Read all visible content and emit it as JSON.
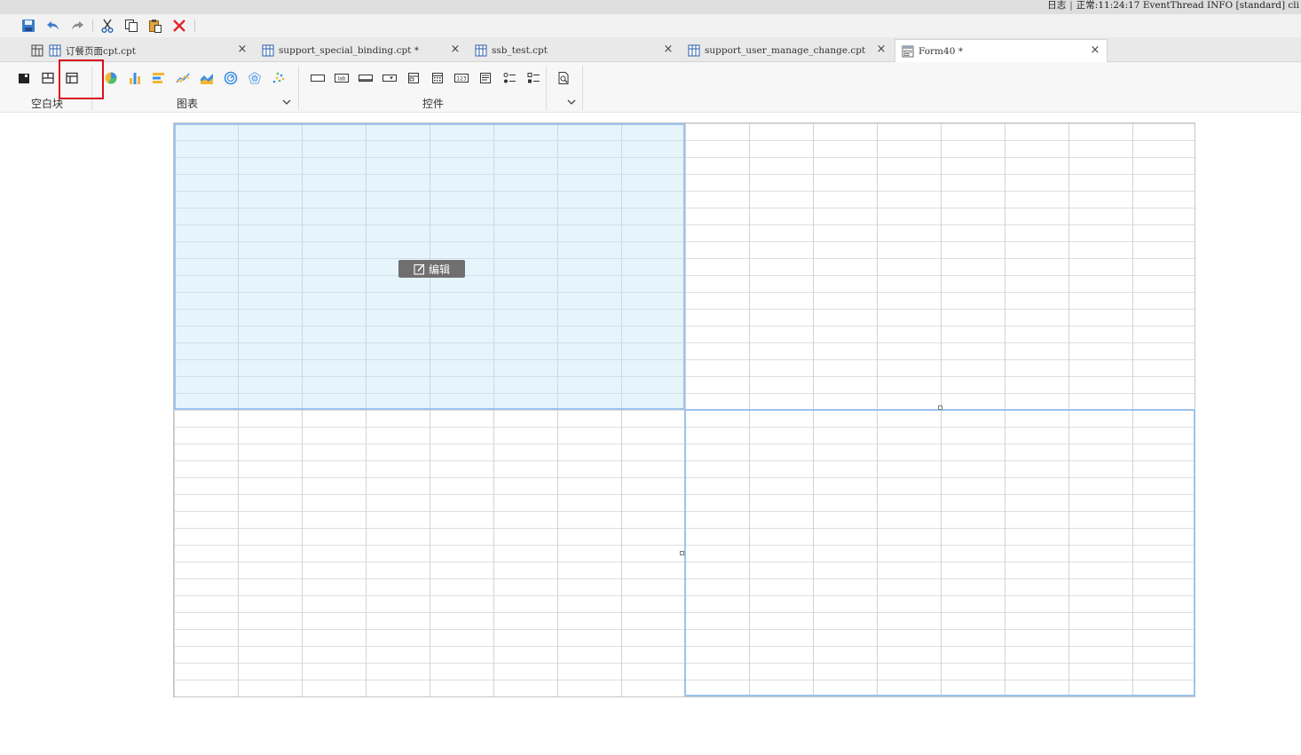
{
  "status": {
    "log_label": "日志",
    "log_message": "正常:11:24:17 EventThread INFO [standard] cli"
  },
  "quickbar": {
    "icons": [
      "save-icon",
      "undo-icon",
      "redo-icon",
      "cut-icon",
      "copy-icon",
      "paste-icon",
      "delete-icon"
    ]
  },
  "tabs": [
    {
      "label": "订餐页面cpt.cpt",
      "icon": "report-icon",
      "active": false
    },
    {
      "label": "support_special_binding.cpt *",
      "icon": "report-icon",
      "active": false
    },
    {
      "label": "ssb_test.cpt",
      "icon": "report-icon",
      "active": false
    },
    {
      "label": "support_user_manage_change.cpt",
      "icon": "report-icon",
      "active": false
    },
    {
      "label": "Form40 *",
      "icon": "form-icon",
      "active": true
    }
  ],
  "tab_close_glyph": "×",
  "ribbon": {
    "blank_group": {
      "label": "空白块",
      "icons": [
        "absolute-layout-icon",
        "tab-layout-icon",
        "frame-layout-icon"
      ]
    },
    "chart_group": {
      "label": "图表",
      "icons": [
        "pie-chart-icon",
        "column-chart-icon",
        "bar-chart-icon",
        "line-chart-icon",
        "area-chart-icon",
        "gauge-chart-icon",
        "radar-chart-icon",
        "scatter-chart-icon"
      ]
    },
    "widget_group": {
      "label": "控件",
      "icons": [
        "text-field-icon",
        "label-icon",
        "button-icon",
        "combo-box-icon",
        "date-field-icon",
        "calendar-icon",
        "number-field-icon",
        "list-icon",
        "radio-group-icon",
        "checkbox-group-icon",
        "search-icon"
      ],
      "lab_text": "lab",
      "num_text": "123"
    }
  },
  "canvas": {
    "edit_label": "编辑"
  },
  "colors": {
    "selection_border": "#9cc3ec",
    "selection_fill": "#bee2f8",
    "highlight_box": "#d8121f",
    "edit_button": "#6f6f6f"
  }
}
